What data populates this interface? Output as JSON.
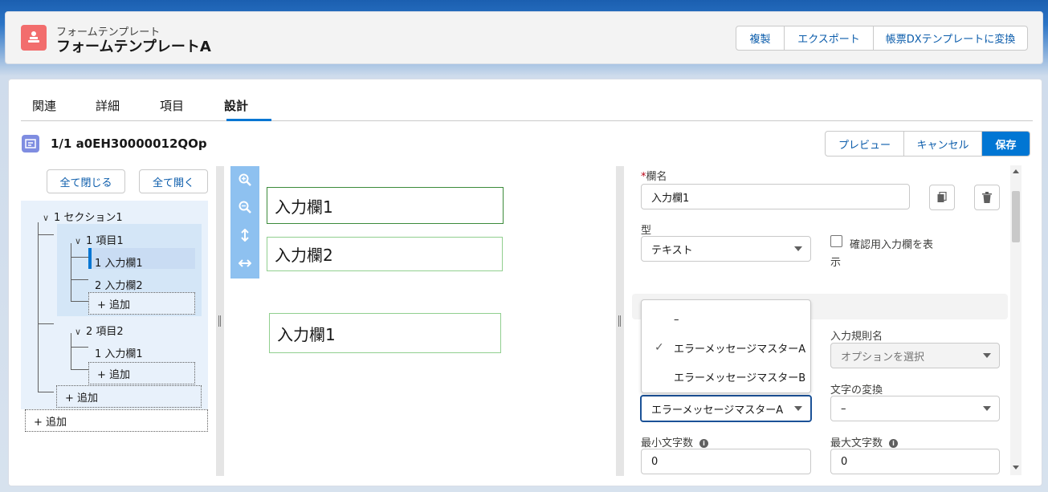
{
  "header": {
    "object_label": "フォームテンプレート",
    "record_title": "フォームテンプレートA",
    "actions": [
      "複製",
      "エクスポート",
      "帳票DXテンプレートに変換"
    ]
  },
  "tabs": [
    "関連",
    "詳細",
    "項目",
    "設計"
  ],
  "active_tab": "設計",
  "record_bar": {
    "title": "1/1 a0EH30000012QOp",
    "actions": [
      "プレビュー",
      "キャンセル",
      "保存"
    ]
  },
  "tree": {
    "collapse_all": "全て閉じる",
    "expand_all": "全て開く",
    "section1": "1 セクション1",
    "item1": "1 項目1",
    "field1": "1 入力欄1",
    "field2": "2 入力欄2",
    "add": "+ 追加",
    "item2": "2 項目2",
    "item2_field1": "1 入力欄1"
  },
  "canvas": {
    "fields": [
      "入力欄1",
      "入力欄2",
      "入力欄1"
    ]
  },
  "props": {
    "name_label": "欄名",
    "required_mark": "*",
    "name_value": "入力欄1",
    "type_label": "型",
    "type_value": "テキスト",
    "confirm_label_line1": "確認用入力欄を表",
    "confirm_label_line2": "示",
    "rule_name_label": "入力規則名",
    "rule_name_placeholder": "オプションを選択",
    "error_msg_value": "エラーメッセージマスターA",
    "char_convert_label": "文字の変換",
    "char_convert_value": "–",
    "min_len_label": "最小文字数",
    "min_len_value": "0",
    "max_len_label": "最大文字数",
    "max_len_value": "0"
  },
  "dropdown": {
    "options": [
      "–",
      "エラーメッセージマスターA",
      "エラーメッセージマスターB"
    ],
    "selected_index": 1
  },
  "colors": {
    "brand": "#0176d3",
    "app_icon": "#f26d6d",
    "field_border": "#91cf8f"
  }
}
